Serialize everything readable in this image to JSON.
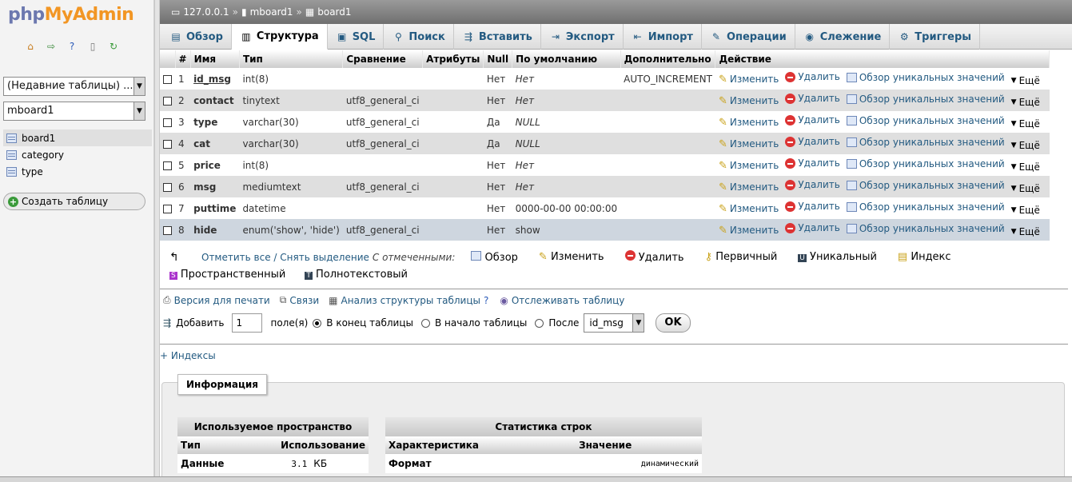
{
  "nav": {
    "logo_php": "php",
    "logo_myadmin": "MyAdmin",
    "recent_tables": "(Недавние таблицы) ...",
    "database_select": "mboard1",
    "tables": [
      "board1",
      "category",
      "type"
    ],
    "new_table": "Создать таблицу"
  },
  "breadcrumb": {
    "server": "127.0.0.1",
    "sep1": "»",
    "database": "mboard1",
    "sep2": "»",
    "table": "board1"
  },
  "tabs": [
    {
      "label": "Обзор",
      "icon": "browse-icon"
    },
    {
      "label": "Структура",
      "icon": "structure-icon",
      "active": true
    },
    {
      "label": "SQL",
      "icon": "sql-icon"
    },
    {
      "label": "Поиск",
      "icon": "search-icon"
    },
    {
      "label": "Вставить",
      "icon": "insert-icon"
    },
    {
      "label": "Экспорт",
      "icon": "export-icon"
    },
    {
      "label": "Импорт",
      "icon": "import-icon"
    },
    {
      "label": "Операции",
      "icon": "operations-icon"
    },
    {
      "label": "Слежение",
      "icon": "tracking-icon"
    },
    {
      "label": "Триггеры",
      "icon": "triggers-icon"
    }
  ],
  "structure": {
    "headers": [
      "#",
      "Имя",
      "Тип",
      "Сравнение",
      "Атрибуты",
      "Null",
      "По умолчанию",
      "Дополнительно",
      "Действие"
    ],
    "rows": [
      {
        "num": "1",
        "name": "id_msg",
        "type": "int(8)",
        "collation": "",
        "attributes": "",
        "null": "Нет",
        "default": "Нет",
        "extra": "AUTO_INCREMENT"
      },
      {
        "num": "2",
        "name": "contact",
        "type": "tinytext",
        "collation": "utf8_general_ci",
        "attributes": "",
        "null": "Нет",
        "default": "Нет",
        "extra": ""
      },
      {
        "num": "3",
        "name": "type",
        "type": "varchar(30)",
        "collation": "utf8_general_ci",
        "attributes": "",
        "null": "Да",
        "default": "NULL",
        "extra": ""
      },
      {
        "num": "4",
        "name": "cat",
        "type": "varchar(30)",
        "collation": "utf8_general_ci",
        "attributes": "",
        "null": "Да",
        "default": "NULL",
        "extra": ""
      },
      {
        "num": "5",
        "name": "price",
        "type": "int(8)",
        "collation": "",
        "attributes": "",
        "null": "Нет",
        "default": "Нет",
        "extra": ""
      },
      {
        "num": "6",
        "name": "msg",
        "type": "mediumtext",
        "collation": "utf8_general_ci",
        "attributes": "",
        "null": "Нет",
        "default": "Нет",
        "extra": ""
      },
      {
        "num": "7",
        "name": "puttime",
        "type": "datetime",
        "collation": "",
        "attributes": "",
        "null": "Нет",
        "default": "0000-00-00 00:00:00",
        "extra": ""
      },
      {
        "num": "8",
        "name": "hide",
        "type": "enum('show', 'hide')",
        "collation": "utf8_general_ci",
        "attributes": "",
        "null": "Нет",
        "default": "show",
        "extra": ""
      }
    ],
    "actions": {
      "change": "Изменить",
      "drop": "Удалить",
      "browse_distinct": "Обзор уникальных значений",
      "more": "Ещё"
    }
  },
  "bulk": {
    "check_all": "Отметить все / Снять выделение",
    "with_selected": "С отмеченными:",
    "browse": "Обзор",
    "change": "Изменить",
    "drop": "Удалить",
    "primary": "Первичный",
    "unique": "Уникальный",
    "index": "Индекс",
    "spatial": "Пространственный",
    "fulltext": "Полнотекстовый"
  },
  "links": {
    "print": "Версия для печати",
    "relations": "Связи",
    "propose": "Анализ структуры таблицы",
    "track": "Отслеживать таблицу"
  },
  "add_field": {
    "label": "Добавить",
    "count": "1",
    "fields_label": "поле(я)",
    "at_end": "В конец таблицы",
    "at_start": "В начало таблицы",
    "after": "После",
    "after_field": "id_msg",
    "ok": "OK"
  },
  "indexes_link": "+ Индексы",
  "info": {
    "legend": "Информация",
    "space": {
      "caption": "Используемое пространство",
      "col_type": "Тип",
      "col_usage": "Использование",
      "row_label": "Данные",
      "row_value": "3.1",
      "row_unit": "КБ"
    },
    "stats": {
      "caption": "Статистика строк",
      "col_stat": "Характеристика",
      "col_value": "Значение",
      "row_label": "Формат",
      "row_value": "динамический"
    }
  }
}
